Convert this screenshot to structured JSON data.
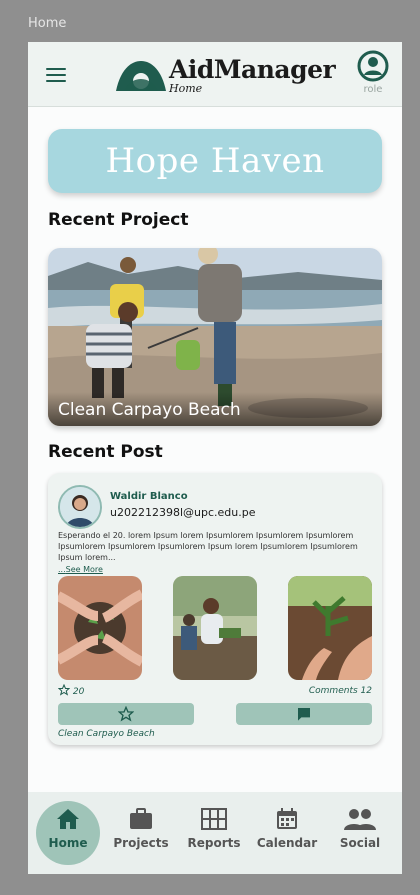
{
  "frame_label": "Home",
  "header": {
    "app_name": "AidManager",
    "subtitle": "Home",
    "role_label": "role"
  },
  "hero": {
    "title": "Hope Haven"
  },
  "recent_project": {
    "section_title": "Recent Project",
    "project_name": "Clean Carpayo Beach"
  },
  "recent_post": {
    "section_title": "Recent Post",
    "author": "Waldir Blanco",
    "email": "u202212398l@upc.edu.pe",
    "body": "Esperando el 20. lorem Ipsum lorem Ipsumlorem Ipsumlorem Ipsumlorem Ipsumlorem Ipsumlorem Ipsumlorem Ipsum lorem Ipsumlorem Ipsumlorem Ipsum lorem...",
    "see_more": "See More",
    "star_count": "20",
    "comments_label": "Comments",
    "comments_count": "12",
    "project_name": "Clean Carpayo Beach"
  },
  "bottom_nav": {
    "items": [
      {
        "label": "Home",
        "icon": "home-icon",
        "active": true
      },
      {
        "label": "Projects",
        "icon": "briefcase-icon",
        "active": false
      },
      {
        "label": "Reports",
        "icon": "grid-icon",
        "active": false
      },
      {
        "label": "Calendar",
        "icon": "calendar-icon",
        "active": false
      },
      {
        "label": "Social",
        "icon": "people-icon",
        "active": false
      }
    ]
  },
  "colors": {
    "brand": "#1f5c4e",
    "hero_bg": "#a7d7df",
    "button_bg": "#9fc4b8",
    "nav_bg": "#e9efed"
  }
}
